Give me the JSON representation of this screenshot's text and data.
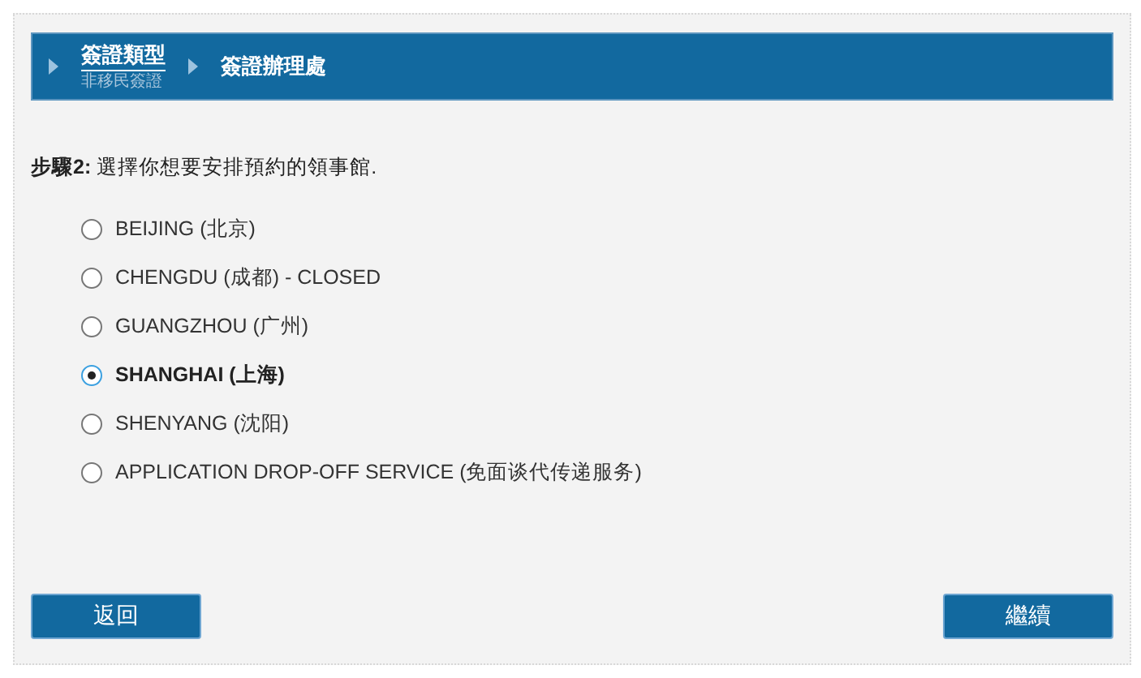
{
  "breadcrumb": [
    {
      "label": "簽證類型",
      "sublabel": "非移民簽證",
      "selected": true
    },
    {
      "label": "簽證辦理處",
      "selected": false
    }
  ],
  "step": {
    "text": "**步驟2:** 選擇你想要安排預約的領事館."
  },
  "options": [
    {
      "label": "BEIJING (北京)",
      "selected": false
    },
    {
      "label": "CHENGDU (成都) - CLOSED",
      "selected": false
    },
    {
      "label": "GUANGZHOU (广州)",
      "selected": false
    },
    {
      "label": "SHANGHAI (上海)",
      "selected": true
    },
    {
      "label": "SHENYANG (沈阳)",
      "selected": false
    },
    {
      "label": "APPLICATION DROP-OFF SERVICE (免面谈代传递服务)",
      "selected": false
    }
  ],
  "buttons": {
    "back": "返回",
    "next": "繼續"
  }
}
